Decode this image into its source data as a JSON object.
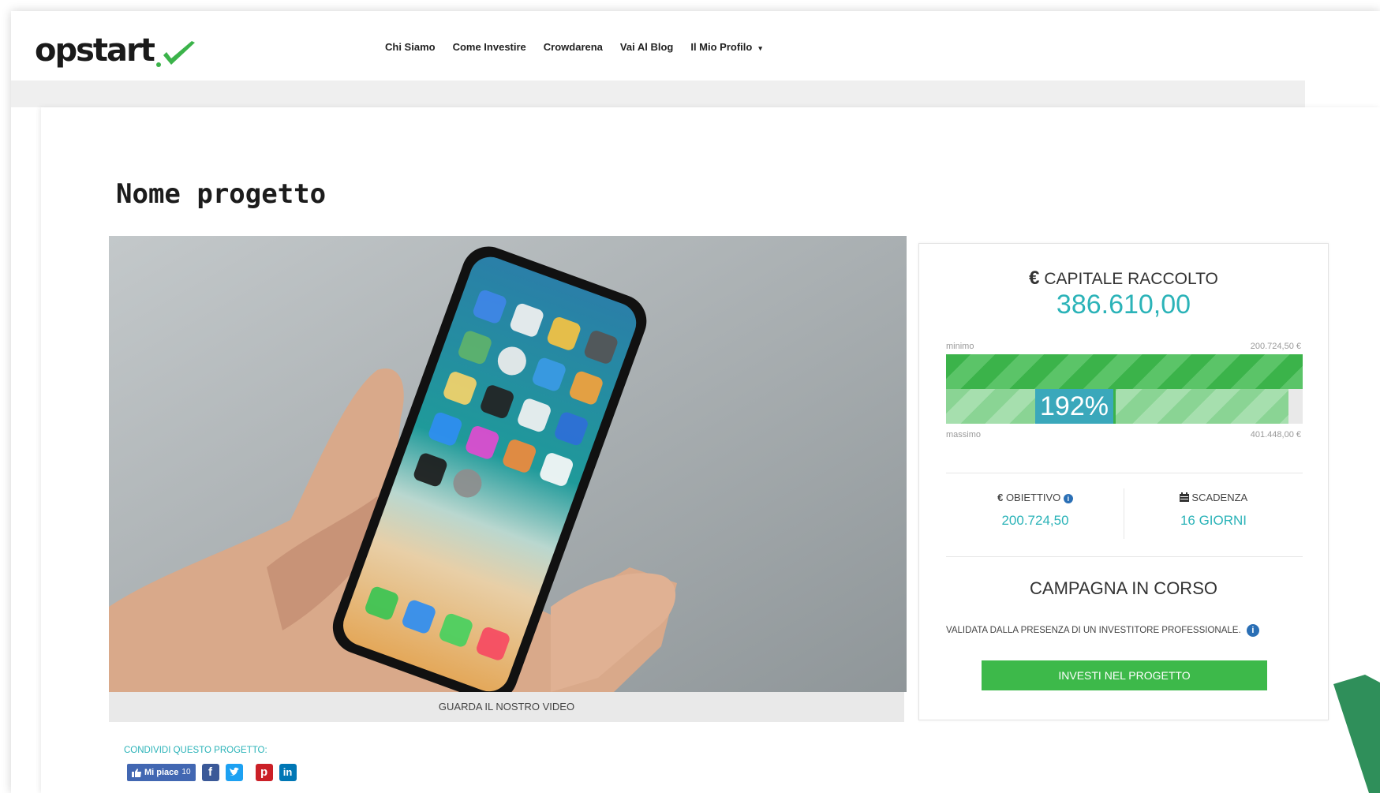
{
  "brand": {
    "logo_text": "opstart",
    "accent": "#3bb34a",
    "teal": "#2bb3b8"
  },
  "nav": {
    "items": [
      "Chi Siamo",
      "Come Investire",
      "Crowdarena",
      "Vai Al Blog",
      "Il Mio Profilo"
    ],
    "caret": "▾"
  },
  "project": {
    "title": "Nome progetto",
    "video_caption": "GUARDA IL NOSTRO VIDEO"
  },
  "funding": {
    "capital_label": "CAPITALE RACCOLTO",
    "currency": "€",
    "capital_value": "386.610,00",
    "min_label": "minimo",
    "min_value": "200.724,50 €",
    "max_label": "massimo",
    "max_value": "401.448,00 €",
    "percent_label": "192%",
    "progress_vs_max": 0.96,
    "goal_label": "OBIETTIVO",
    "goal_value": "200.724,50",
    "deadline_label": "SCADENZA",
    "deadline_value": "16 GIORNI",
    "campaign_status": "CAMPAGNA IN CORSO",
    "validated_text": "VALIDATA DALLA PRESENZA DI UN INVESTITORE PROFESSIONALE.",
    "invest_button": "INVESTI NEL PROGETTO"
  },
  "share": {
    "label": "CONDIVIDI QUESTO PROGETTO:",
    "like_label": "Mi piace",
    "like_count": "10",
    "icons": [
      "facebook-icon",
      "twitter-icon",
      "pinterest-icon",
      "linkedin-icon"
    ]
  }
}
